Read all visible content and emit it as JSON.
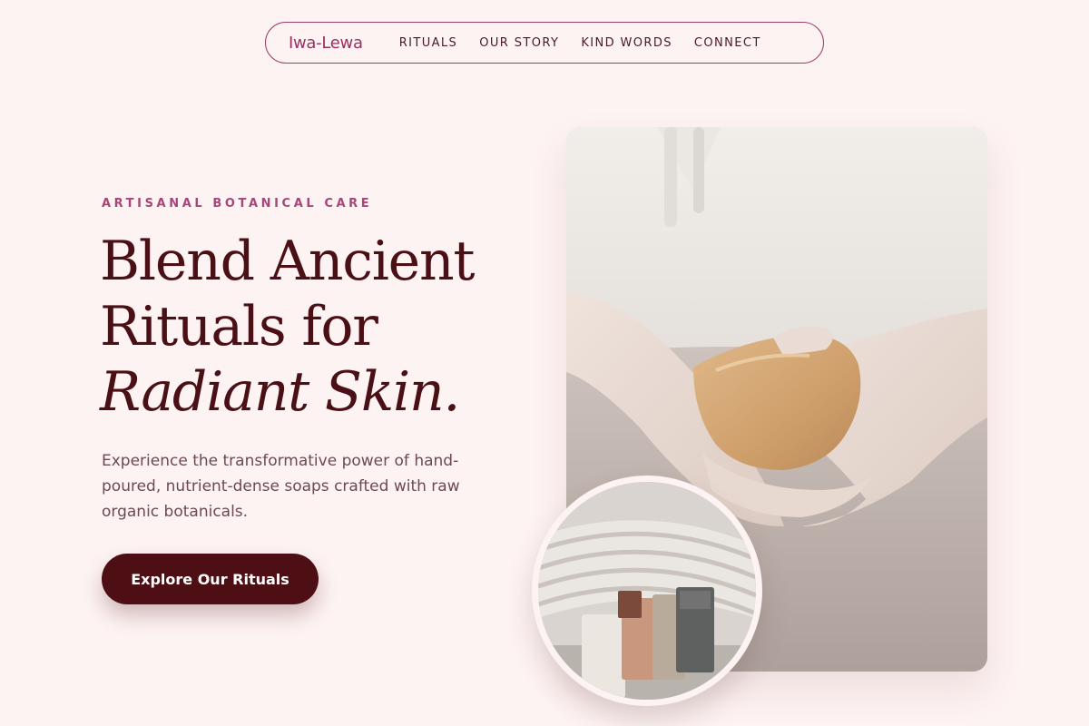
{
  "nav": {
    "brand": "Iwa-Lewa",
    "links": [
      "RITUALS",
      "OUR STORY",
      "KIND WORDS",
      "CONNECT"
    ]
  },
  "hero": {
    "eyebrow": "ARTISANAL BOTANICAL CARE",
    "headline_line1": "Blend Ancient",
    "headline_line2": "Rituals for",
    "headline_line3": "Radiant Skin.",
    "subcopy": "Experience the transformative power of hand-poured, nutrient-dense soaps crafted with raw organic botanicals.",
    "cta_label": "Explore Our Rituals"
  },
  "images": {
    "main_alt": "Hands holding a bar of handmade soap",
    "circle_alt": "Stack of handmade soap bars on a towel"
  },
  "colors": {
    "background": "#fdf3f2",
    "brand": "#9c3060",
    "headline": "#4a1016",
    "cta": "#4e0f14",
    "eyebrow": "#a8457a"
  }
}
